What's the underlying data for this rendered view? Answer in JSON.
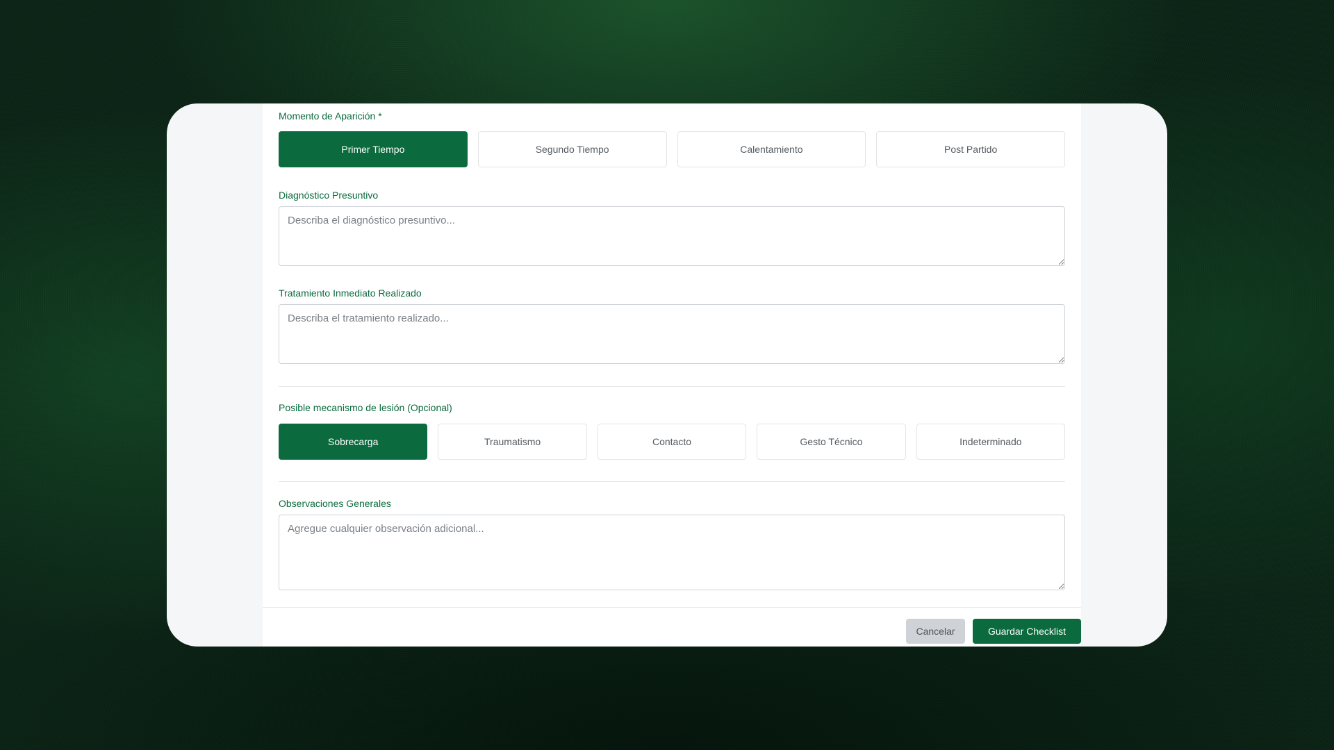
{
  "form": {
    "moment": {
      "label": "Momento de Aparición *",
      "options": [
        "Primer Tiempo",
        "Segundo Tiempo",
        "Calentamiento",
        "Post Partido"
      ],
      "selected": "Primer Tiempo"
    },
    "diagnosis": {
      "label": "Diagnóstico Presuntivo",
      "placeholder": "Describa el diagnóstico presuntivo...",
      "value": ""
    },
    "treatment": {
      "label": "Tratamiento Inmediato Realizado",
      "placeholder": "Describa el tratamiento realizado...",
      "value": ""
    },
    "mechanism": {
      "label": "Posible mecanismo de lesión (Opcional)",
      "options": [
        "Sobrecarga",
        "Traumatismo",
        "Contacto",
        "Gesto Técnico",
        "Indeterminado"
      ],
      "selected": "Sobrecarga"
    },
    "observations": {
      "label": "Observaciones Generales",
      "placeholder": "Agregue cualquier observación adicional...",
      "value": ""
    }
  },
  "footer": {
    "cancel_label": "Cancelar",
    "save_label": "Guardar Checklist"
  },
  "colors": {
    "accent": "#0b6b3e",
    "label": "#0b6b3e",
    "cancel_bg": "#cfd3d7"
  }
}
